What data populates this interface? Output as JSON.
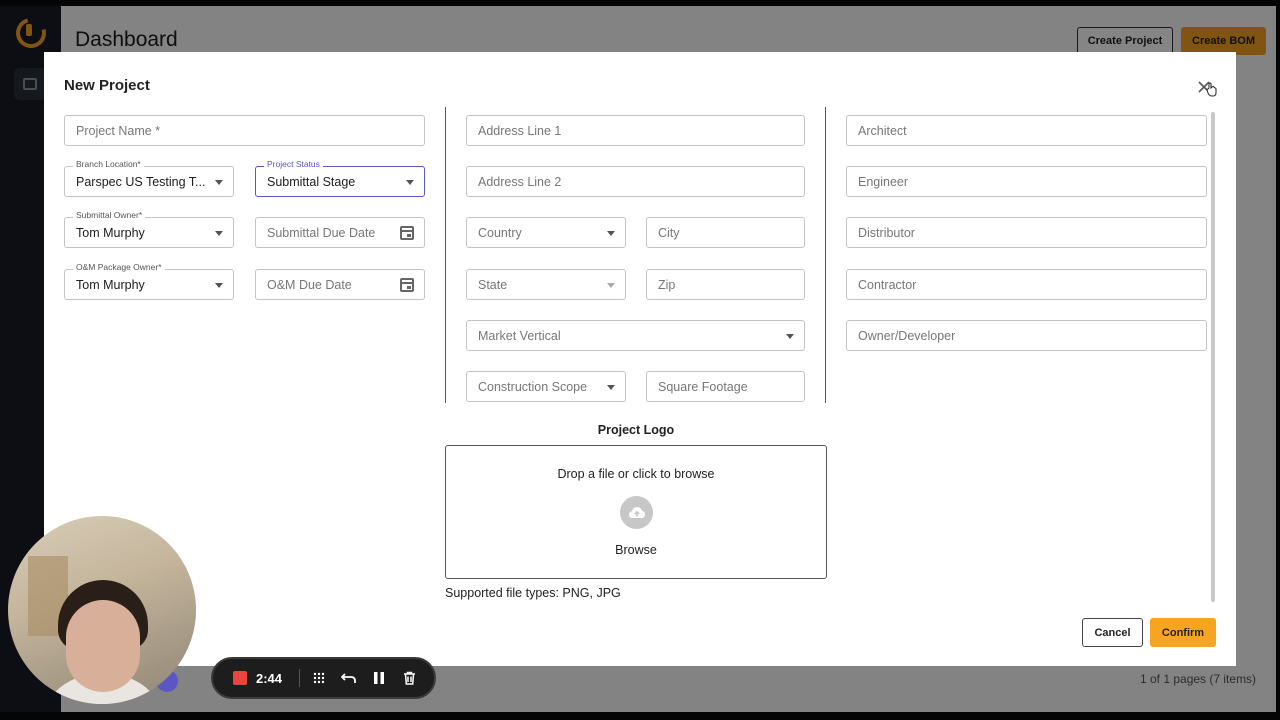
{
  "app": {
    "title": "Dashboard",
    "create_project_label": "Create Project",
    "create_bom_label": "Create BOM",
    "pagination_text": "1 of 1 pages (7 items)"
  },
  "modal": {
    "title": "New Project",
    "left_column": {
      "project_name_placeholder": "Project Name *",
      "branch_location_label": "Branch Location*",
      "branch_location_value": "Parspec US Testing T...",
      "project_status_label": "Project Status",
      "project_status_value": "Submittal Stage",
      "submittal_owner_label": "Submittal Owner*",
      "submittal_owner_value": "Tom Murphy",
      "submittal_due_date_placeholder": "Submittal Due Date",
      "om_package_owner_label": "O&M Package Owner*",
      "om_package_owner_value": "Tom Murphy",
      "om_due_date_placeholder": "O&M Due Date"
    },
    "middle_column": {
      "address_line_1": "Address Line 1",
      "address_line_2": "Address Line 2",
      "country": "Country",
      "city": "City",
      "state": "State",
      "zip": "Zip",
      "market_vertical": "Market Vertical",
      "construction_scope": "Construction Scope",
      "square_footage": "Square Footage"
    },
    "right_column": {
      "architect": "Architect",
      "engineer": "Engineer",
      "distributor": "Distributor",
      "contractor": "Contractor",
      "owner_developer": "Owner/Developer"
    },
    "logo": {
      "title": "Project Logo",
      "drop_text": "Drop a file or click to browse",
      "browse_label": "Browse",
      "supported_text": "Supported file types: PNG, JPG"
    },
    "cancel_label": "Cancel",
    "confirm_label": "Confirm"
  },
  "recorder": {
    "time": "2:44"
  },
  "colors": {
    "accent": "#f7a421",
    "focus": "#5b56c4",
    "sidebar": "#171c25",
    "record": "#e8453c"
  }
}
